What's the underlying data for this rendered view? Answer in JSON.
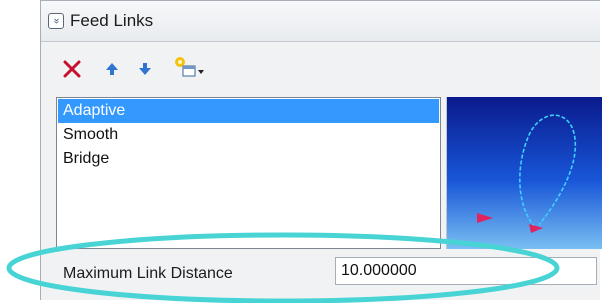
{
  "panel": {
    "title": "Feed Links",
    "collapse_glyph": "»"
  },
  "toolbar": {
    "delete_icon": "delete-x-icon",
    "up_icon": "arrow-up-icon",
    "down_icon": "arrow-down-icon",
    "add_icon": "add-dropdown-icon"
  },
  "list": {
    "items": [
      {
        "label": "Adaptive",
        "selected": true
      },
      {
        "label": "Smooth",
        "selected": false
      },
      {
        "label": "Bridge",
        "selected": false
      }
    ]
  },
  "parameter": {
    "label": "Maximum Link Distance",
    "value": "10.000000"
  },
  "colors": {
    "selection": "#3399ff",
    "highlight_ellipse": "#48d4d4",
    "preview_path": "#3fd0ff",
    "preview_arrows": "#e0245e"
  }
}
